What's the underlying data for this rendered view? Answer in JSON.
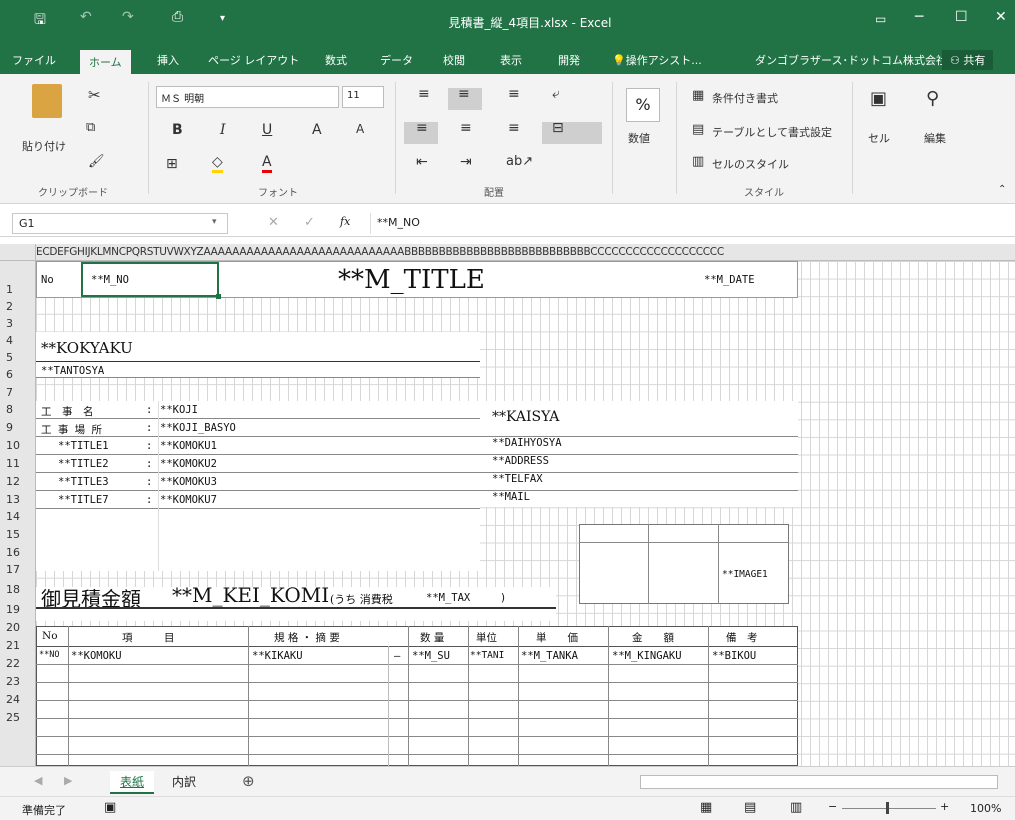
{
  "window": {
    "title": "見積書_縦_4項目.xlsx - Excel"
  },
  "tabs": [
    "ファイル",
    "ホーム",
    "挿入",
    "ページ レイアウト",
    "数式",
    "データ",
    "校閲",
    "表示",
    "開発"
  ],
  "tell_me": "操作アシスト...",
  "account": "ダンゴブラザース･ドットコム株式会社",
  "share": "共有",
  "ribbon": {
    "clipboard": {
      "paste": "貼り付け",
      "label": "クリップボード"
    },
    "font": {
      "name": "ＭＳ 明朝",
      "size": "11",
      "label": "フォント"
    },
    "alignment": {
      "label": "配置"
    },
    "number": {
      "format": "数値",
      "pct": "%"
    },
    "styles": {
      "conditional": "条件付き書式",
      "as_table": "テーブルとして書式設定",
      "cell_styles": "セルのスタイル",
      "label": "スタイル"
    },
    "cells": {
      "label": "セル"
    },
    "editing": {
      "label": "編集"
    }
  },
  "formula_bar": {
    "name_box": "G1",
    "formula": "**M_NO"
  },
  "columns_header": "ECDEFGHIJKLMNCPQRSTUVWXYZAAAAAAAAAAAAAAAAAAAAAAAAAAAABBBBBBBBBBBBBBBBBBBBBBBBBBBCCCCCCCCCCCCCCCCCCC",
  "rows": [
    "1",
    "2",
    "3",
    "4",
    "5",
    "6",
    "7",
    "8",
    "9",
    "10",
    "11",
    "12",
    "13",
    "14",
    "15",
    "16",
    "17",
    "18",
    "19",
    "20",
    "21",
    "22",
    "23",
    "24",
    "25"
  ],
  "sheet": {
    "no_label": "No",
    "m_no": "**M_NO",
    "title": "**M_TITLE",
    "date": "**M_DATE",
    "kokyaku": "**KOKYAKU",
    "tantosya": "**TANTOSYA",
    "info_rows": [
      {
        "label": "工　事　名",
        "val": "**KOJI"
      },
      {
        "label": "工 事 場 所",
        "val": "**KOJI_BASYO"
      },
      {
        "label": "**TITLE1",
        "val": "**KOMOKU1"
      },
      {
        "label": "**TITLE2",
        "val": "**KOMOKU2"
      },
      {
        "label": "**TITLE3",
        "val": "**KOMOKU3"
      },
      {
        "label": "**TITLE7",
        "val": "**KOMOKU7"
      }
    ],
    "kaisya": "**KAISYA",
    "daihyosya": "**DAIHYOSYA",
    "address": "**ADDRESS",
    "telfax": "**TELFAX",
    "mail": "**MAIL",
    "image": "**IMAGE1",
    "total_label": "御見積金額",
    "total_value": "**M_KEI_KOMI",
    "tax_label": "(うち 消費税",
    "tax_value": "**M_TAX",
    "tax_close": ")",
    "table_headers": [
      "No",
      "項　　　目",
      "規 格 ・ 摘 要",
      "数 量",
      "単位",
      "単　　価",
      "金　　額",
      "備　考"
    ],
    "table_row": [
      "**NO",
      "**KOMOKU",
      "**KIKAKU",
      "—",
      "**M_SU",
      "**TANI",
      "**M_TANKA",
      "**M_KINGAKU",
      "**BIKOU"
    ]
  },
  "sheet_tabs": [
    "表紙",
    "内訳"
  ],
  "status": {
    "ready": "準備完了",
    "zoom": "100%"
  },
  "colors": {
    "excel_green": "#217346"
  }
}
